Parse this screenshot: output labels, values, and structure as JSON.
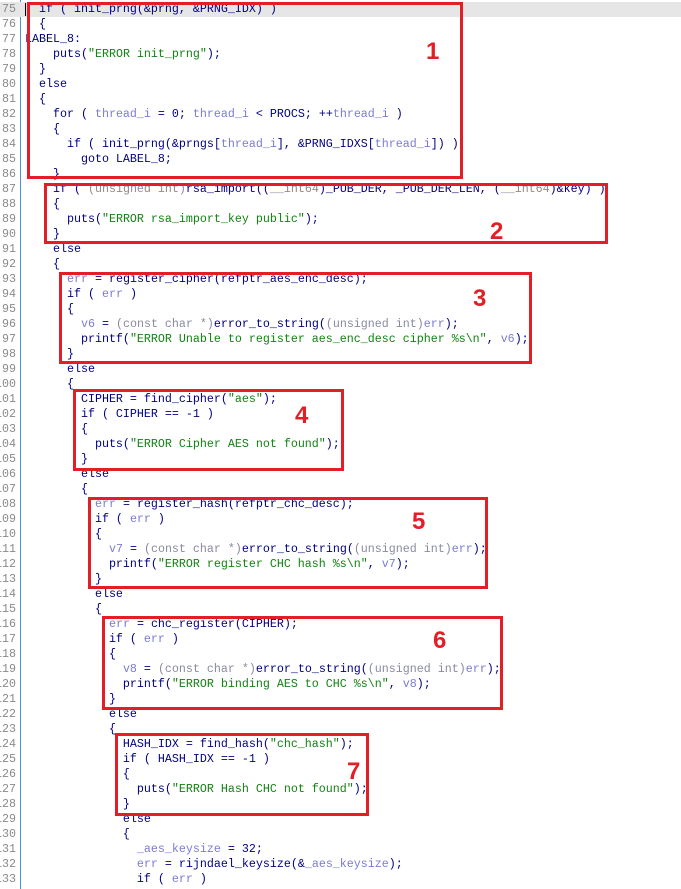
{
  "editor": {
    "current_line": 75,
    "lines": [
      {
        "n": "75",
        "seg": [
          [
            "d",
            "  if ( init_prng(&prng, &PRNG_IDX) )"
          ]
        ]
      },
      {
        "n": "76",
        "seg": [
          [
            "d",
            "  {"
          ]
        ]
      },
      {
        "n": "77",
        "seg": [
          [
            "d",
            "LABEL_8:"
          ]
        ]
      },
      {
        "n": "78",
        "seg": [
          [
            "d",
            "    puts("
          ],
          [
            "s",
            "\"ERROR init_prng\""
          ],
          [
            "d",
            ");"
          ]
        ]
      },
      {
        "n": "79",
        "seg": [
          [
            "d",
            "  }"
          ]
        ]
      },
      {
        "n": "80",
        "seg": [
          [
            "d",
            "  else"
          ]
        ]
      },
      {
        "n": "81",
        "seg": [
          [
            "d",
            "  {"
          ]
        ]
      },
      {
        "n": "82",
        "seg": [
          [
            "d",
            "    for ( "
          ],
          [
            "v",
            "thread_i"
          ],
          [
            "d",
            " = 0; "
          ],
          [
            "v",
            "thread_i"
          ],
          [
            "d",
            " < PROCS; ++"
          ],
          [
            "v",
            "thread_i"
          ],
          [
            "d",
            " )"
          ]
        ]
      },
      {
        "n": "83",
        "seg": [
          [
            "d",
            "    {"
          ]
        ]
      },
      {
        "n": "84",
        "seg": [
          [
            "d",
            "      if ( init_prng(&prngs["
          ],
          [
            "v",
            "thread_i"
          ],
          [
            "d",
            "], &PRNG_IDXS["
          ],
          [
            "v",
            "thread_i"
          ],
          [
            "d",
            "]) )"
          ]
        ]
      },
      {
        "n": "85",
        "seg": [
          [
            "d",
            "        goto LABEL_8;"
          ]
        ]
      },
      {
        "n": "86",
        "seg": [
          [
            "d",
            "    }"
          ]
        ]
      },
      {
        "n": "87",
        "seg": [
          [
            "d",
            "    if ( "
          ],
          [
            "t",
            "(unsigned int)"
          ],
          [
            "d",
            "rsa_import(("
          ],
          [
            "t",
            "__int64"
          ],
          [
            "d",
            ")_PUB_DER, _PUB_DER_LEN, ("
          ],
          [
            "t",
            "__int64"
          ],
          [
            "d",
            ")&key) )"
          ]
        ]
      },
      {
        "n": "88",
        "seg": [
          [
            "d",
            "    {"
          ]
        ]
      },
      {
        "n": "89",
        "seg": [
          [
            "d",
            "      puts("
          ],
          [
            "s",
            "\"ERROR rsa_import_key public\""
          ],
          [
            "d",
            ");"
          ]
        ]
      },
      {
        "n": "90",
        "seg": [
          [
            "d",
            "    }"
          ]
        ]
      },
      {
        "n": "91",
        "seg": [
          [
            "d",
            "    else"
          ]
        ]
      },
      {
        "n": "92",
        "seg": [
          [
            "d",
            "    {"
          ]
        ]
      },
      {
        "n": "93",
        "seg": [
          [
            "d",
            "      "
          ],
          [
            "v",
            "err"
          ],
          [
            "d",
            " = register_cipher(refptr_aes_enc_desc);"
          ]
        ]
      },
      {
        "n": "94",
        "seg": [
          [
            "d",
            "      if ( "
          ],
          [
            "v",
            "err"
          ],
          [
            "d",
            " )"
          ]
        ]
      },
      {
        "n": "95",
        "seg": [
          [
            "d",
            "      {"
          ]
        ]
      },
      {
        "n": "96",
        "seg": [
          [
            "d",
            "        "
          ],
          [
            "v",
            "v6"
          ],
          [
            "d",
            " = "
          ],
          [
            "t",
            "(const char *)"
          ],
          [
            "d",
            "error_to_string("
          ],
          [
            "t",
            "(unsigned int)"
          ],
          [
            "v",
            "err"
          ],
          [
            "d",
            ");"
          ]
        ]
      },
      {
        "n": "97",
        "seg": [
          [
            "d",
            "        printf("
          ],
          [
            "s",
            "\"ERROR Unable to register aes_enc_desc cipher %s\\n\""
          ],
          [
            "d",
            ", "
          ],
          [
            "v",
            "v6"
          ],
          [
            "d",
            ");"
          ]
        ]
      },
      {
        "n": "98",
        "seg": [
          [
            "d",
            "      }"
          ]
        ]
      },
      {
        "n": "99",
        "seg": [
          [
            "d",
            "      else"
          ]
        ]
      },
      {
        "n": "100",
        "seg": [
          [
            "d",
            "      {"
          ]
        ]
      },
      {
        "n": "101",
        "seg": [
          [
            "d",
            "        CIPHER = find_cipher("
          ],
          [
            "s",
            "\"aes\""
          ],
          [
            "d",
            ");"
          ]
        ]
      },
      {
        "n": "102",
        "seg": [
          [
            "d",
            "        if ( CIPHER == -1 )"
          ]
        ]
      },
      {
        "n": "103",
        "seg": [
          [
            "d",
            "        {"
          ]
        ]
      },
      {
        "n": "104",
        "seg": [
          [
            "d",
            "          puts("
          ],
          [
            "s",
            "\"ERROR Cipher AES not found\""
          ],
          [
            "d",
            ");"
          ]
        ]
      },
      {
        "n": "105",
        "seg": [
          [
            "d",
            "        }"
          ]
        ]
      },
      {
        "n": "106",
        "seg": [
          [
            "d",
            "        else"
          ]
        ]
      },
      {
        "n": "107",
        "seg": [
          [
            "d",
            "        {"
          ]
        ]
      },
      {
        "n": "108",
        "seg": [
          [
            "d",
            "          "
          ],
          [
            "v",
            "err"
          ],
          [
            "d",
            " = register_hash(refptr_chc_desc);"
          ]
        ]
      },
      {
        "n": "109",
        "seg": [
          [
            "d",
            "          if ( "
          ],
          [
            "v",
            "err"
          ],
          [
            "d",
            " )"
          ]
        ]
      },
      {
        "n": "110",
        "seg": [
          [
            "d",
            "          {"
          ]
        ]
      },
      {
        "n": "111",
        "seg": [
          [
            "d",
            "            "
          ],
          [
            "v",
            "v7"
          ],
          [
            "d",
            " = "
          ],
          [
            "t",
            "(const char *)"
          ],
          [
            "d",
            "error_to_string("
          ],
          [
            "t",
            "(unsigned int)"
          ],
          [
            "v",
            "err"
          ],
          [
            "d",
            ");"
          ]
        ]
      },
      {
        "n": "112",
        "seg": [
          [
            "d",
            "            printf("
          ],
          [
            "s",
            "\"ERROR register CHC hash %s\\n\""
          ],
          [
            "d",
            ", "
          ],
          [
            "v",
            "v7"
          ],
          [
            "d",
            ");"
          ]
        ]
      },
      {
        "n": "113",
        "seg": [
          [
            "d",
            "          }"
          ]
        ]
      },
      {
        "n": "114",
        "seg": [
          [
            "d",
            "          else"
          ]
        ]
      },
      {
        "n": "115",
        "seg": [
          [
            "d",
            "          {"
          ]
        ]
      },
      {
        "n": "116",
        "seg": [
          [
            "d",
            "            "
          ],
          [
            "v",
            "err"
          ],
          [
            "d",
            " = chc_register(CIPHER);"
          ]
        ]
      },
      {
        "n": "117",
        "seg": [
          [
            "d",
            "            if ( "
          ],
          [
            "v",
            "err"
          ],
          [
            "d",
            " )"
          ]
        ]
      },
      {
        "n": "118",
        "seg": [
          [
            "d",
            "            {"
          ]
        ]
      },
      {
        "n": "119",
        "seg": [
          [
            "d",
            "              "
          ],
          [
            "v",
            "v8"
          ],
          [
            "d",
            " = "
          ],
          [
            "t",
            "(const char *)"
          ],
          [
            "d",
            "error_to_string("
          ],
          [
            "t",
            "(unsigned int)"
          ],
          [
            "v",
            "err"
          ],
          [
            "d",
            ");"
          ]
        ]
      },
      {
        "n": "120",
        "seg": [
          [
            "d",
            "              printf("
          ],
          [
            "s",
            "\"ERROR binding AES to CHC %s\\n\""
          ],
          [
            "d",
            ", "
          ],
          [
            "v",
            "v8"
          ],
          [
            "d",
            ");"
          ]
        ]
      },
      {
        "n": "121",
        "seg": [
          [
            "d",
            "            }"
          ]
        ]
      },
      {
        "n": "122",
        "seg": [
          [
            "d",
            "            else"
          ]
        ]
      },
      {
        "n": "123",
        "seg": [
          [
            "d",
            "            {"
          ]
        ]
      },
      {
        "n": "124",
        "seg": [
          [
            "d",
            "              HASH_IDX = find_hash("
          ],
          [
            "s",
            "\"chc_hash\""
          ],
          [
            "d",
            ");"
          ]
        ]
      },
      {
        "n": "125",
        "seg": [
          [
            "d",
            "              if ( HASH_IDX == -1 )"
          ]
        ]
      },
      {
        "n": "126",
        "seg": [
          [
            "d",
            "              {"
          ]
        ]
      },
      {
        "n": "127",
        "seg": [
          [
            "d",
            "                puts("
          ],
          [
            "s",
            "\"ERROR Hash CHC not found\""
          ],
          [
            "d",
            ");"
          ]
        ]
      },
      {
        "n": "128",
        "seg": [
          [
            "d",
            "              }"
          ]
        ]
      },
      {
        "n": "129",
        "seg": [
          [
            "d",
            "              else"
          ]
        ]
      },
      {
        "n": "130",
        "seg": [
          [
            "d",
            "              {"
          ]
        ]
      },
      {
        "n": "131",
        "seg": [
          [
            "d",
            "                "
          ],
          [
            "v",
            "_aes_keysize"
          ],
          [
            "d",
            " = 32;"
          ]
        ]
      },
      {
        "n": "132",
        "seg": [
          [
            "d",
            "                "
          ],
          [
            "v",
            "err"
          ],
          [
            "d",
            " = rijndael_keysize(&"
          ],
          [
            "v",
            "_aes_keysize"
          ],
          [
            "d",
            ");"
          ]
        ]
      },
      {
        "n": "133",
        "seg": [
          [
            "d",
            "                if ( "
          ],
          [
            "v",
            "err"
          ],
          [
            "d",
            " )"
          ]
        ]
      }
    ]
  },
  "annotations": {
    "color": "#e31e26",
    "labels": [
      "1",
      "2",
      "3",
      "4",
      "5",
      "6",
      "7"
    ]
  }
}
